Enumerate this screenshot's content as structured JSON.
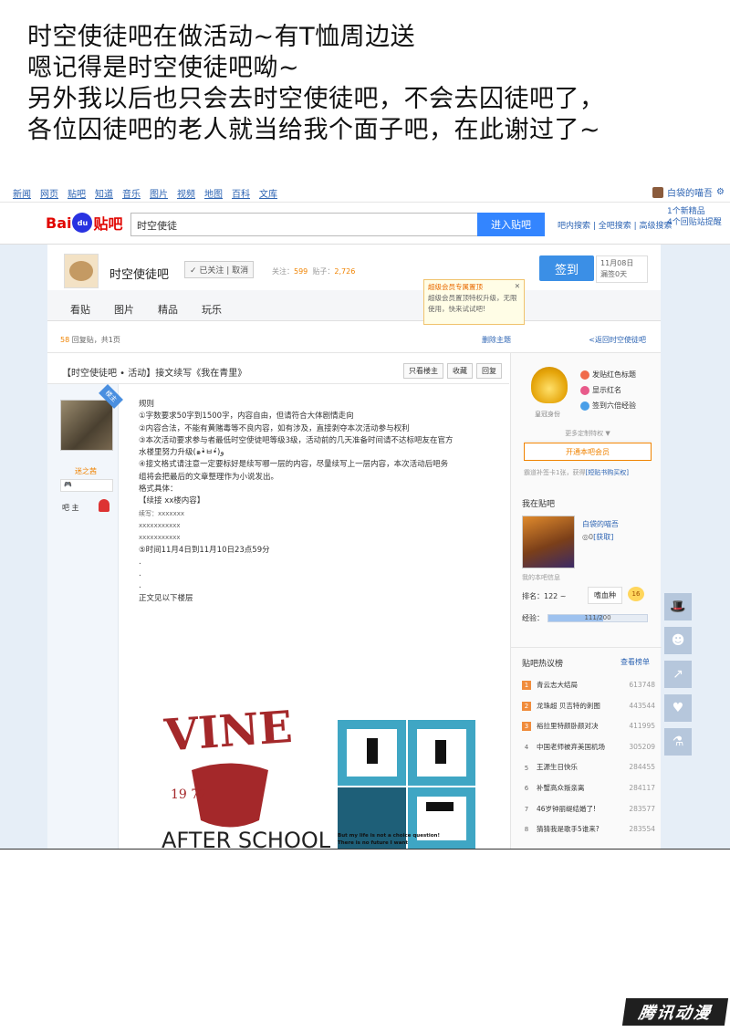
{
  "caption": [
    "时空使徒吧在做活动~有T恤周边送",
    "嗯记得是时空使徒吧呦~",
    "另外我以后也只会去时空使徒吧，不会去囚徒吧了，",
    "各位囚徒吧的老人就当给我个面子吧，在此谢过了~"
  ],
  "topnav": {
    "links": [
      "新闻",
      "网页",
      "贴吧",
      "知道",
      "音乐",
      "图片",
      "视频",
      "地图",
      "百科",
      "文库"
    ],
    "username": "白袋的喵吾"
  },
  "search": {
    "logo_bai": "Bai",
    "logo_du": "du",
    "logo_tieba": "贴吧",
    "query": "时空使徒",
    "button": "进入贴吧",
    "links": "吧内搜索 | 全吧搜索 | 高级搜索",
    "notice": [
      "1个新精品",
      "4个回贴站提醒"
    ]
  },
  "forum": {
    "name": "时空使徒吧",
    "follow": "✓ 已关注 | 取消",
    "stats_follow_label": "关注：",
    "stats_follow": "599",
    "stats_posts_label": "贴子：",
    "stats_posts": "2,726",
    "sign_button": "签到",
    "sign_date": "11月08日",
    "sign_streak": "漏签0天"
  },
  "popup": {
    "title": "超级会员专属置顶",
    "content": "超级会员置顶特权升级，无限使用，快来试试吧!"
  },
  "tabs": [
    "看贴",
    "图片",
    "精品",
    "玩乐"
  ],
  "pagebar": {
    "count": "58",
    "count_suffix": " 回复贴，共1页",
    "delete": "删除主题",
    "back": "<返回时空使徒吧"
  },
  "thread": {
    "title": "【时空使徒吧 • 活动】接文续写《我在青里》",
    "buttons": [
      "只看楼主",
      "收藏",
      "回复"
    ],
    "author_name": "迷之茜",
    "author_role": "吧 主",
    "badge": "楼主"
  },
  "post": {
    "lines": [
      "规则",
      "①字数要求50字到1500字，内容自由，但请符合大体剧情走向",
      "②内容合法，不能有黄赌毒等不良内容，如有涉及，直接剥夺本次活动参与权利",
      "③本次活动要求参与者最低时空使徒吧等级3级，活动前的几天准备时间请不达标吧友在官方",
      "水楼里努力升级(๑•̀ㅂ•́)و",
      "④接文格式请注意一定要标好是续写哪一层的内容，尽量续写上一层内容，本次活动后吧务",
      "组将会把最后的文章整理作为小说发出。",
      "格式具体：",
      "【续接 xx楼内容】",
      "续写：xxxxxxx",
      "xxxxxxxxxxx",
      "xxxxxxxxxxx",
      "⑤时间11月4日到11月10日23点59分",
      ".",
      ".",
      "."
    ],
    "below": "正文见以下楼层",
    "image_text_vine": "VINE",
    "image_text_year": "19 72",
    "image_text_after": "AFTER SCHOOL",
    "image_text_q1": "But my life is not a choice question!",
    "image_text_q2": "There is no future I want"
  },
  "sidebar": {
    "crown_label": "皇冠身份",
    "privs": [
      "发贴红色标题",
      "显示红名",
      "签到六倍经验"
    ],
    "more": "更多定制特权 ▼",
    "open_vip": "开通本吧会员",
    "reply_note": "霸道补签卡1张，获得",
    "reply_link": "[短贴书购买权]",
    "mybar_title": "我在贴吧",
    "my_name": "白袋的喵吾",
    "my_coin_num": "0",
    "my_coin_link": "[获取]",
    "my_info": "我的本吧信息",
    "rank": "排名：122 ~",
    "level_name": "嗜血种",
    "level_num": "16",
    "exp_label": "经验：",
    "exp_text": "111/200",
    "exp_fraction": 0.555
  },
  "hot": {
    "title": "贴吧热议榜",
    "more": "查看榜单",
    "items": [
      {
        "n": "1",
        "t": "青云志大结局",
        "c": "613748"
      },
      {
        "n": "2",
        "t": "龙珠超 贝吉特的刺图",
        "c": "443544"
      },
      {
        "n": "3",
        "t": "裕拉里特颜卧颜对决",
        "c": "411995"
      },
      {
        "n": "4",
        "t": "中国老师被弃美国机场",
        "c": "305209"
      },
      {
        "n": "5",
        "t": "王源生日快乐",
        "c": "284455"
      },
      {
        "n": "6",
        "t": "补蟹高众叛亲离",
        "c": "284117"
      },
      {
        "n": "7",
        "t": "46岁钟丽缇结婚了!",
        "c": "283577"
      },
      {
        "n": "8",
        "t": "猜猜我是歌手5谁来?",
        "c": "283554"
      }
    ]
  },
  "watermark": "腾讯动漫",
  "colors": {
    "accent": "#3385ff",
    "brand": "#e10601",
    "highlight": "#f08300"
  }
}
